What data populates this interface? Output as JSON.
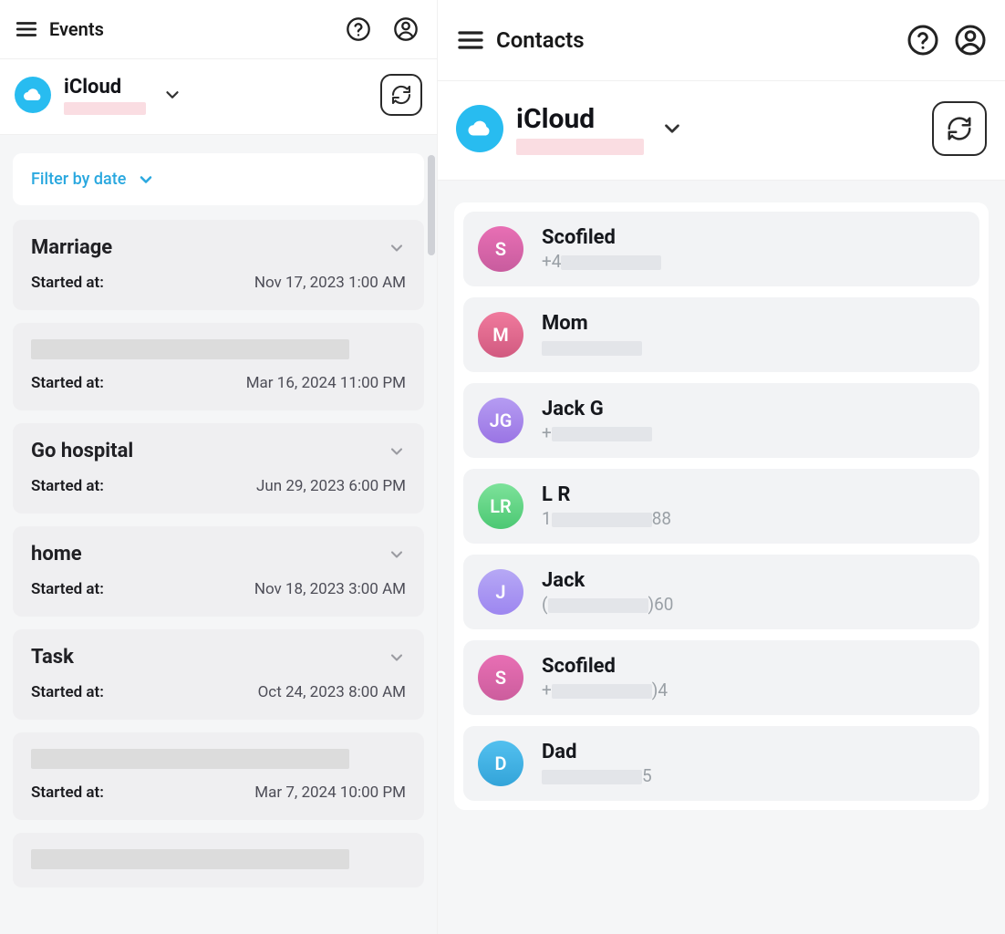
{
  "events": {
    "header_title": "Events",
    "account_name": "iCloud",
    "filter_label": "Filter by date",
    "started_at_label": "Started at:",
    "items": [
      {
        "title": "Marriage",
        "title_redacted": false,
        "time": "Nov 17, 2023 1:00 AM"
      },
      {
        "title": "",
        "title_redacted": true,
        "time": "Mar 16, 2024 11:00 PM"
      },
      {
        "title": "Go hospital",
        "title_redacted": false,
        "time": "Jun 29, 2023 6:00 PM"
      },
      {
        "title": "home",
        "title_redacted": false,
        "time": "Nov 18, 2023 3:00 AM"
      },
      {
        "title": "Task",
        "title_redacted": false,
        "time": "Oct 24, 2023 8:00 AM"
      },
      {
        "title": "",
        "title_redacted": true,
        "time": "Mar 7, 2024 10:00 PM"
      },
      {
        "title": "",
        "title_redacted": true,
        "time": ""
      }
    ]
  },
  "contacts": {
    "header_title": "Contacts",
    "account_name": "iCloud",
    "items": [
      {
        "initials": "S",
        "avatar_class": "c-av-S",
        "name": "Scofiled",
        "phone_visible_prefix": "+4",
        "phone_visible_suffix": ""
      },
      {
        "initials": "M",
        "avatar_class": "c-av-M",
        "name": "Mom",
        "phone_visible_prefix": "",
        "phone_visible_suffix": ""
      },
      {
        "initials": "JG",
        "avatar_class": "c-av-JG",
        "name": "Jack G",
        "phone_visible_prefix": "+",
        "phone_visible_suffix": ""
      },
      {
        "initials": "LR",
        "avatar_class": "c-av-LR",
        "name": "L R",
        "phone_visible_prefix": "1",
        "phone_visible_suffix": "88"
      },
      {
        "initials": "J",
        "avatar_class": "c-av-J",
        "name": "Jack",
        "phone_visible_prefix": "(",
        "phone_visible_suffix": ")60"
      },
      {
        "initials": "S",
        "avatar_class": "c-av-S2",
        "name": "Scofiled",
        "phone_visible_prefix": "+",
        "phone_visible_suffix": ")4"
      },
      {
        "initials": "D",
        "avatar_class": "c-av-D",
        "name": "Dad",
        "phone_visible_prefix": "",
        "phone_visible_suffix": "5"
      }
    ]
  }
}
